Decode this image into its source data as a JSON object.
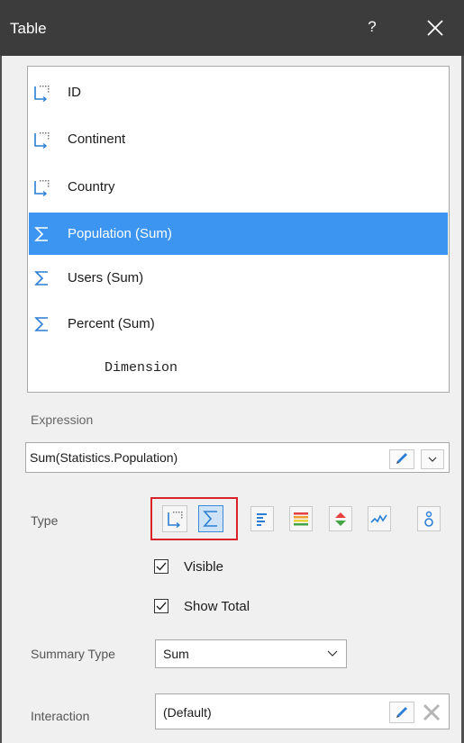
{
  "window": {
    "title": "Table",
    "help_label": "?"
  },
  "fields": [
    {
      "label": "ID",
      "kind": "dimension",
      "icon": "dimension-icon"
    },
    {
      "label": "Continent",
      "kind": "dimension",
      "icon": "dimension-icon"
    },
    {
      "label": "Country",
      "kind": "dimension",
      "icon": "dimension-icon"
    },
    {
      "label": "Population (Sum)",
      "kind": "measure",
      "icon": "sigma-icon",
      "selected": true
    },
    {
      "label": "Users (Sum)",
      "kind": "measure",
      "icon": "sigma-icon"
    },
    {
      "label": "Percent (Sum)",
      "kind": "measure",
      "icon": "sigma-icon"
    }
  ],
  "fieldlist_footer": "Dimension",
  "expression": {
    "label": "Expression",
    "value": "Sum(Statistics.Population)"
  },
  "type": {
    "label": "Type",
    "buttons": [
      {
        "icon": "dimension-icon",
        "selected": false
      },
      {
        "icon": "sigma-icon",
        "selected": true
      },
      {
        "icon": "bars-icon",
        "selected": false
      },
      {
        "icon": "color-scale-icon",
        "selected": false
      },
      {
        "icon": "indicator-arrows-icon",
        "selected": false
      },
      {
        "icon": "sparkline-icon",
        "selected": false
      },
      {
        "icon": "bubble-icon",
        "selected": false
      }
    ]
  },
  "visible": {
    "label": "Visible",
    "checked": true
  },
  "show_total": {
    "label": "Show Total",
    "checked": true
  },
  "summary_type": {
    "label": "Summary Type",
    "value": "Sum"
  },
  "interaction": {
    "label": "Interaction",
    "value": "(Default)"
  },
  "colors": {
    "titlebar": "#3c3c3c",
    "selection": "#3d95f2",
    "highlight_border": "#d9232a",
    "accent_blue": "#2a7fd4"
  }
}
